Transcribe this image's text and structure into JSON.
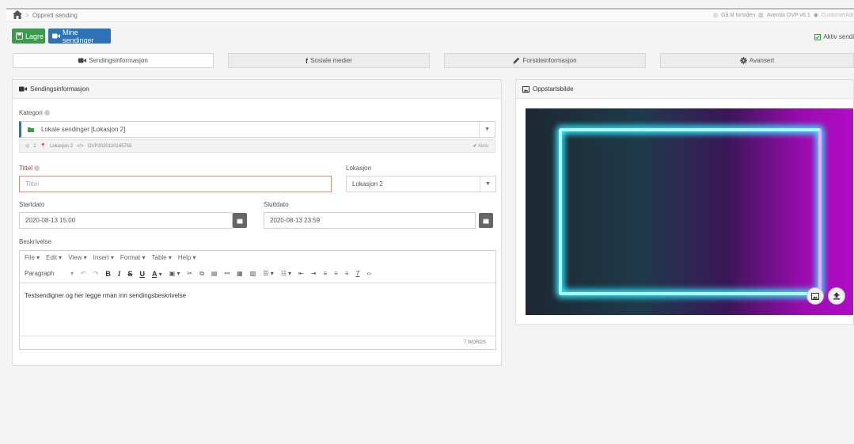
{
  "breadcrumb": {
    "separator": ">",
    "current": "Opprett sending"
  },
  "top_links": {
    "home_link": "Gå til forsiden",
    "version": "Aventia OVP v6.1",
    "user": "CustomerAdr"
  },
  "toolbar": {
    "save_label": "Lagre",
    "my_broadcasts_label": "Mine sendinger",
    "active_label": "Aktiv sendi"
  },
  "tabs": [
    {
      "label": "Sendingsinformasjon",
      "icon": "video-camera-icon",
      "active": true
    },
    {
      "label": "Sosiale medier",
      "icon": "facebook-icon",
      "active": false
    },
    {
      "label": "Forsideinformasjon",
      "icon": "pencil-icon",
      "active": false
    },
    {
      "label": "Avansert",
      "icon": "gear-icon",
      "active": false
    }
  ],
  "info_panel": {
    "title": "Sendingsinformasjon",
    "kategori_label": "Kategori",
    "kategori_value": "Lokale sendinger [Lokasjon 2]",
    "kategori_meta": {
      "count": "1",
      "location": "Lokasjon 2",
      "code": "OVP2020110145759",
      "status": "Aktiv"
    },
    "tittel_label": "Tittel",
    "tittel_placeholder": "Tittel",
    "lokasjon_label": "Lokasjon",
    "lokasjon_value": "Lokasjon 2",
    "startdato_label": "Startdato",
    "startdato_value": "2020-08-13 15:00",
    "sluttdato_label": "Sluttdato",
    "sluttdato_value": "2020-08-13 23:59",
    "beskrivelse_label": "Beskrivelse"
  },
  "editor": {
    "menu": [
      "File",
      "Edit",
      "View",
      "Insert",
      "Format",
      "Table",
      "Help"
    ],
    "paragraph_label": "Paragraph",
    "bold": "B",
    "italic": "I",
    "strike": "S",
    "underline": "U",
    "font_color": "A",
    "content": "Testsendigner og her legge rman inn sendingsbeskrivelse",
    "word_count": "7 WORDS"
  },
  "image_panel": {
    "title": "Oppstartsbilde"
  },
  "colors": {
    "save_button": "#3a9b4a",
    "my_broadcasts_button": "#2e73b8",
    "error_red": "#c0392b",
    "neon_cyan": "#31e9ff",
    "neon_magenta": "#b00dc5"
  }
}
